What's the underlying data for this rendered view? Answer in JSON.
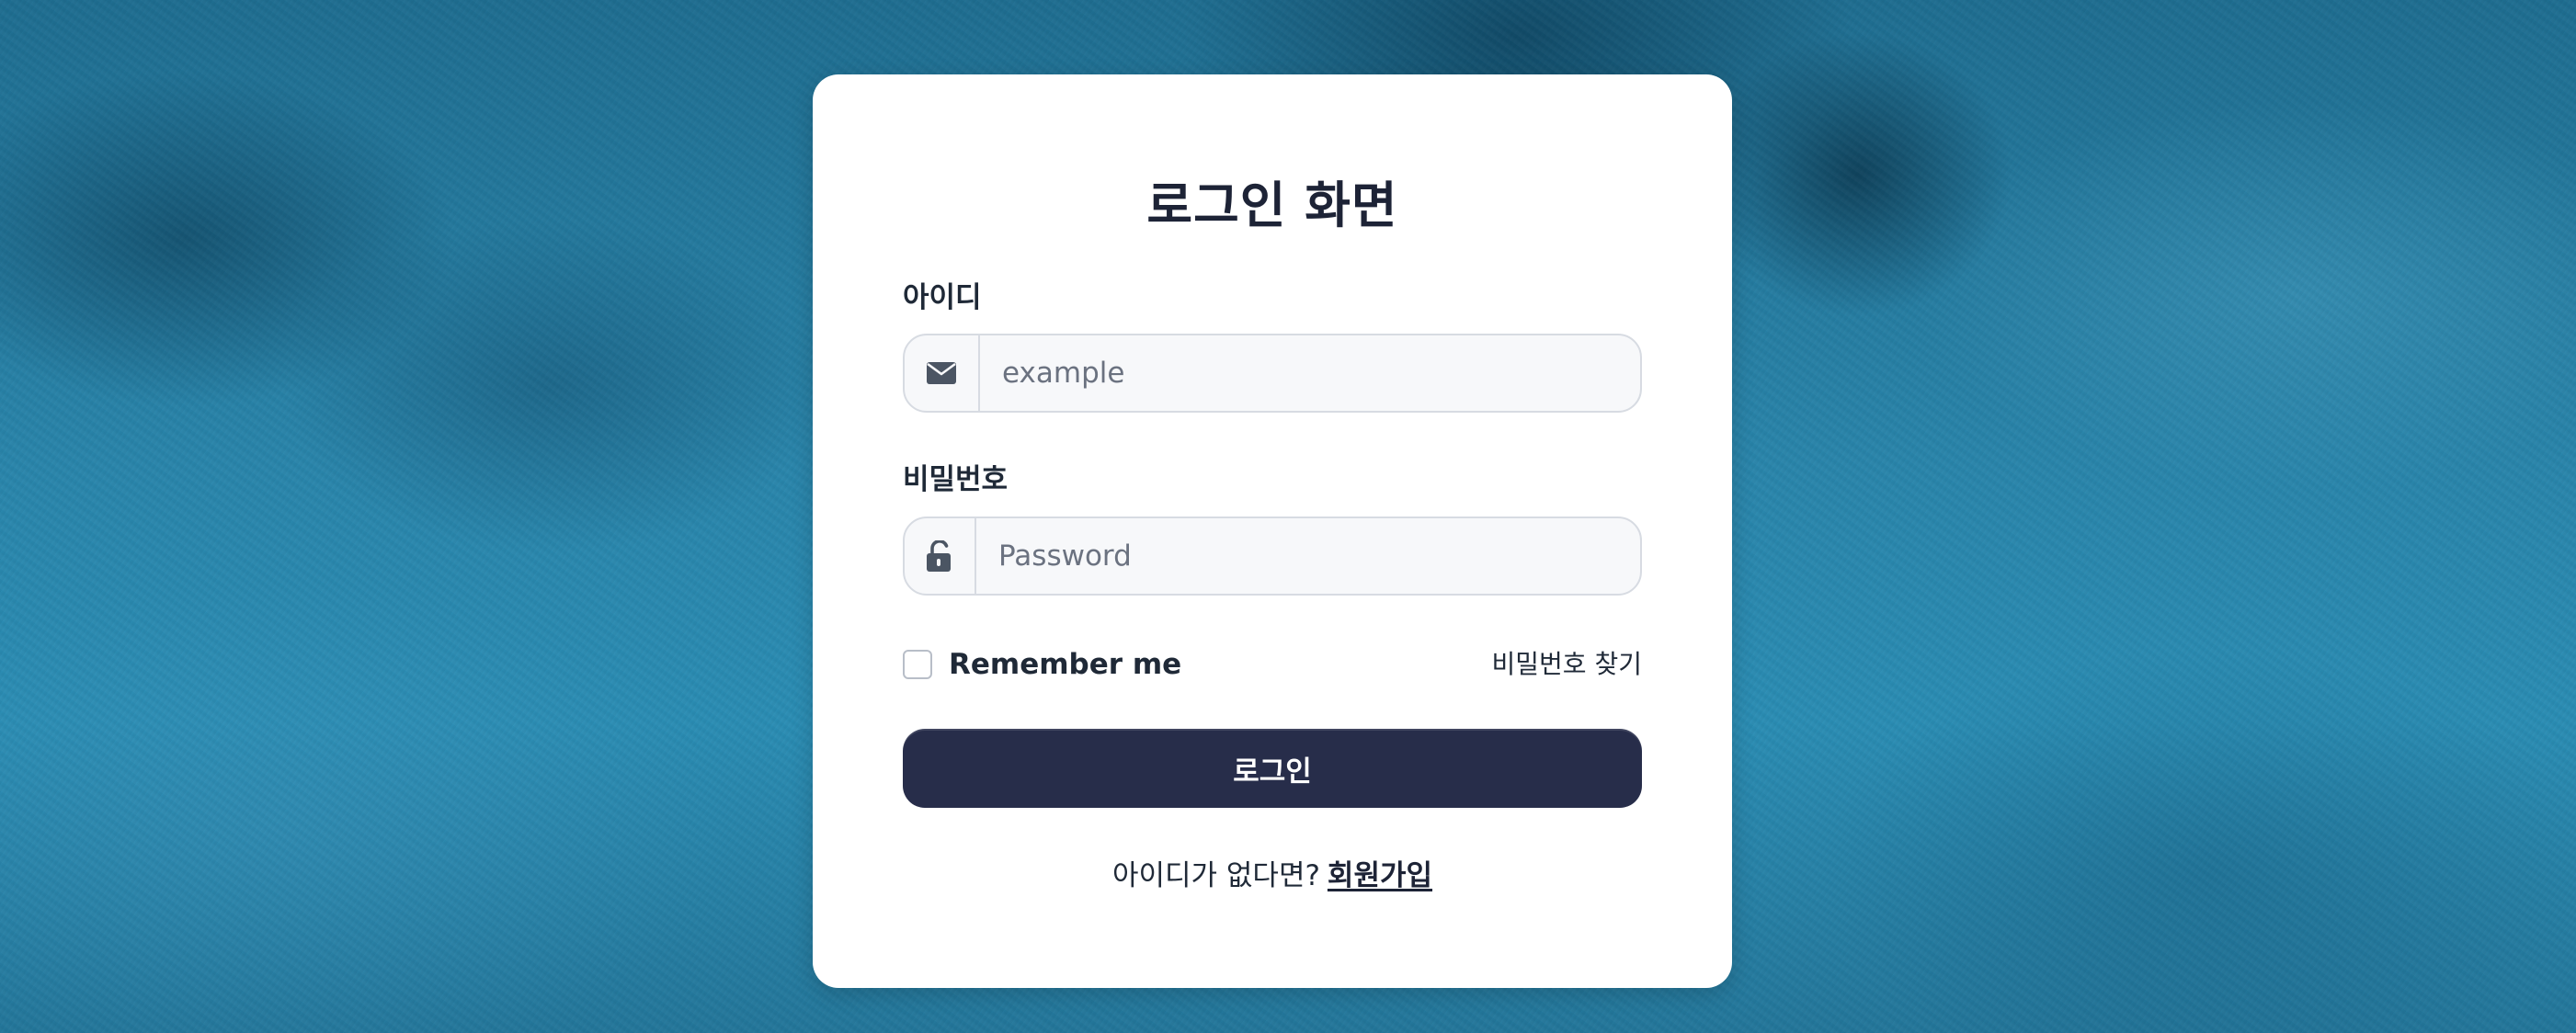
{
  "login": {
    "title": "로그인 화면",
    "id_label": "아이디",
    "id_placeholder": "example",
    "id_value": "",
    "password_label": "비밀번호",
    "password_placeholder": "Password",
    "password_value": "",
    "remember_label": "Remember me",
    "remember_checked": false,
    "forgot_label": "비밀번호 찾기",
    "submit_label": "로그인",
    "signup_prompt": "아이디가 없다면?",
    "signup_link": "회원가입"
  },
  "icons": {
    "id_field": "envelope-icon",
    "password_field": "unlock-icon"
  },
  "colors": {
    "primary_button": "#272d4a",
    "card_background": "#ffffff",
    "field_background": "#f7f8fa"
  }
}
